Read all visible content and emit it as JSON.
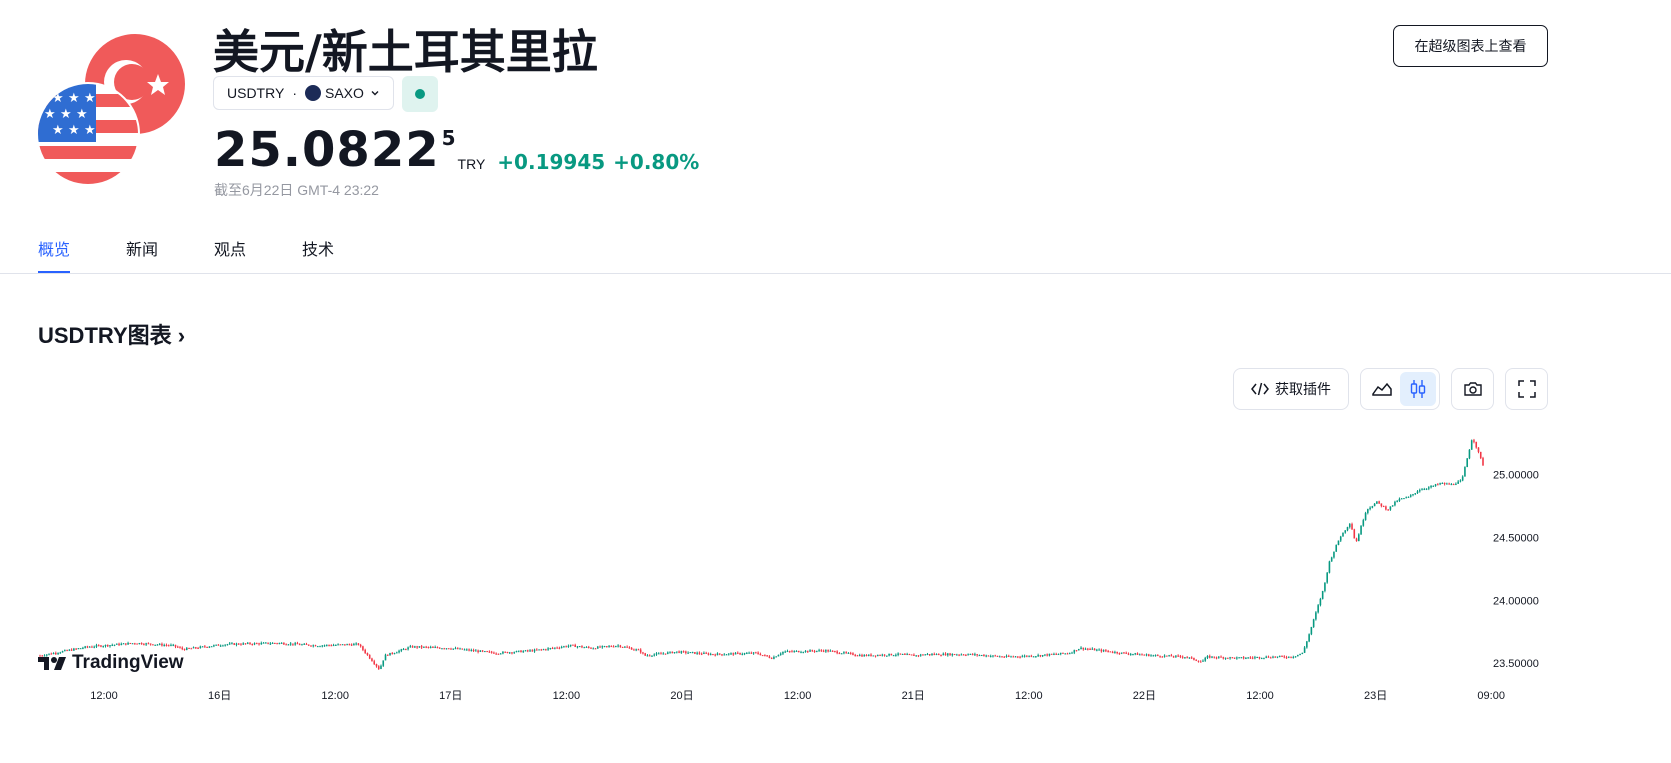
{
  "header": {
    "title": "美元/新土耳其里拉",
    "symbol": "USDTRY",
    "exchange": "SAXO",
    "market_status": "open",
    "advanced_chart_button": "在超级图表上查看"
  },
  "quote": {
    "price_main": "25.0822",
    "price_sup": "5",
    "currency": "TRY",
    "change": "+0.19945",
    "change_percent": "+0.80%",
    "as_of": "截至6月22日 GMT-4 23:22",
    "change_color": "#089981"
  },
  "tabs": [
    {
      "label": "概览",
      "active": true
    },
    {
      "label": "新闻",
      "active": false
    },
    {
      "label": "观点",
      "active": false
    },
    {
      "label": "技术",
      "active": false
    }
  ],
  "chart_section": {
    "title": "USDTRY图表",
    "title_arrow": "›",
    "embed_button": "获取插件",
    "branding": "TradingView"
  },
  "chart_data": {
    "type": "candlestick",
    "title": "",
    "xlabel": "",
    "ylabel": "",
    "x_tick_labels": [
      "12:00",
      "16日",
      "12:00",
      "17日",
      "12:00",
      "20日",
      "12:00",
      "21日",
      "12:00",
      "22日",
      "12:00",
      "23日",
      "09:00"
    ],
    "y_tick_labels": [
      "25.00000",
      "24.50000",
      "24.00000",
      "23.50000"
    ],
    "y_ticks": [
      25.0,
      24.5,
      24.0,
      23.5
    ],
    "ylim": [
      23.35,
      25.45
    ],
    "grid": false,
    "up_color": "#089981",
    "down_color": "#f23645",
    "x": [
      0,
      9,
      18,
      25,
      27,
      35,
      45,
      52,
      60,
      64,
      65,
      70,
      77,
      86,
      93,
      95,
      100,
      104,
      109,
      113,
      114,
      120,
      127,
      135,
      138,
      140,
      148,
      155,
      162,
      165,
      167,
      175,
      182,
      188,
      194,
      196,
      204,
      210,
      216,
      219,
      220,
      226,
      232,
      236,
      238,
      239,
      242,
      243,
      245,
      247,
      248,
      250,
      252,
      254,
      256,
      258,
      260,
      262,
      264,
      266,
      268,
      270,
      272
    ],
    "close": [
      23.56,
      23.63,
      23.66,
      23.64,
      23.61,
      23.65,
      23.66,
      23.64,
      23.65,
      23.45,
      23.56,
      23.63,
      23.62,
      23.58,
      23.6,
      23.61,
      23.64,
      23.62,
      23.64,
      23.6,
      23.56,
      23.59,
      23.57,
      23.58,
      23.54,
      23.59,
      23.6,
      23.56,
      23.57,
      23.56,
      23.57,
      23.57,
      23.55,
      23.56,
      23.58,
      23.62,
      23.58,
      23.56,
      23.55,
      23.51,
      23.55,
      23.54,
      23.55,
      23.55,
      23.58,
      23.7,
      24.1,
      24.3,
      24.5,
      24.62,
      24.45,
      24.72,
      24.78,
      24.72,
      24.8,
      24.82,
      24.88,
      24.9,
      24.93,
      24.92,
      24.95,
      25.3,
      25.08
    ]
  }
}
